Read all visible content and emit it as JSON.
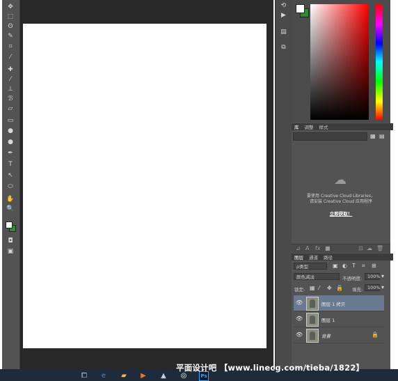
{
  "colors": {
    "toolbar_bg": "#535353",
    "workspace_bg": "#282828",
    "document_bg": "#ffffff",
    "panel_bg": "#535353",
    "selected_layer": "#6a7a90",
    "foreground_color": "#ffffff",
    "background_color": "#2e8b2e",
    "taskbar_bg": "#1f2b3a"
  },
  "tools": [
    {
      "icon": "move-icon",
      "glyph": "✥"
    },
    {
      "icon": "marquee-icon",
      "glyph": "⬚"
    },
    {
      "icon": "lasso-icon",
      "glyph": "ʘ"
    },
    {
      "icon": "quick-select-icon",
      "glyph": "✎"
    },
    {
      "icon": "crop-icon",
      "glyph": "⌗"
    },
    {
      "icon": "eyedropper-icon",
      "glyph": "⁄"
    },
    {
      "icon": "healing-brush-icon",
      "glyph": "✚"
    },
    {
      "icon": "brush-icon",
      "glyph": "⁄"
    },
    {
      "icon": "clone-stamp-icon",
      "glyph": "⊥"
    },
    {
      "icon": "history-brush-icon",
      "glyph": "ℬ"
    },
    {
      "icon": "eraser-icon",
      "glyph": "▱"
    },
    {
      "icon": "gradient-icon",
      "glyph": "▭"
    },
    {
      "icon": "blur-icon",
      "glyph": "●"
    },
    {
      "icon": "dodge-icon",
      "glyph": "●"
    },
    {
      "icon": "pen-icon",
      "glyph": "✒"
    },
    {
      "icon": "type-icon",
      "glyph": "T"
    },
    {
      "icon": "path-select-icon",
      "glyph": "↖"
    },
    {
      "icon": "ellipse-shape-icon",
      "glyph": "⬭"
    },
    {
      "icon": "hand-icon",
      "glyph": "✋"
    },
    {
      "icon": "zoom-icon",
      "glyph": "🔍"
    }
  ],
  "dock": [
    {
      "icon": "history-icon",
      "glyph": "⟲"
    },
    {
      "icon": "actions-play-icon",
      "glyph": "▶"
    },
    {
      "icon": "properties-icon",
      "glyph": "▤"
    },
    {
      "icon": "clone-source-icon",
      "glyph": "⧉"
    }
  ],
  "library_tabs": [
    "库",
    "调整",
    "样式"
  ],
  "library": {
    "message_line1": "要使用 Creative Cloud Libraries，",
    "message_line2": "请安装 Creative Cloud 应用程序",
    "link": "立即获取！"
  },
  "layers_tabs": [
    "图层",
    "通道",
    "路径"
  ],
  "layers": {
    "filter": "ρ类型",
    "blend_mode": "颜色减淡",
    "opacity_label": "不透明度:",
    "opacity_value": "100%",
    "lock_label": "锁定:",
    "fill_label": "填充:",
    "fill_value": "100%",
    "items": [
      {
        "name": "图层 1 拷贝",
        "selected": true
      },
      {
        "name": "图层 1",
        "selected": false
      },
      {
        "name": "背景",
        "selected": false,
        "locked": true
      }
    ]
  },
  "watermark": "平面设计吧 【www.linecg.com/tieba/1822】",
  "taskbar": [
    {
      "icon": "task-view-icon",
      "glyph": "⧠",
      "color": "#d0d0d0"
    },
    {
      "icon": "edge-icon",
      "glyph": "e",
      "color": "#3b8fe0"
    },
    {
      "icon": "file-explorer-icon",
      "glyph": "▰",
      "color": "#e8c24a"
    },
    {
      "icon": "media-player-icon",
      "glyph": "▶",
      "color": "#e87a2a"
    },
    {
      "icon": "photos-icon",
      "glyph": "▲",
      "color": "#c0d0e0"
    },
    {
      "icon": "camera-icon",
      "glyph": "◎",
      "color": "#ffffff"
    },
    {
      "icon": "photoshop-icon",
      "glyph": "Ps",
      "color": "#31a8ff"
    }
  ]
}
